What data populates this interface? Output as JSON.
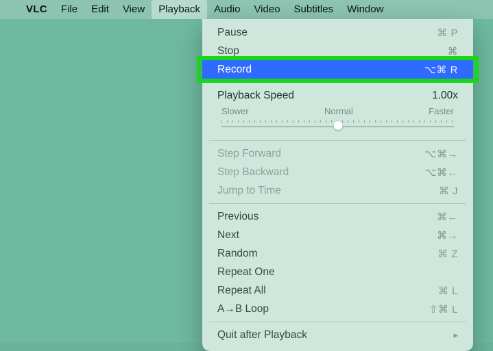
{
  "menubar": {
    "app": "VLC",
    "items": [
      "File",
      "Edit",
      "View",
      "Playback",
      "Audio",
      "Video",
      "Subtitles",
      "Window"
    ],
    "open_index": 3
  },
  "menu": {
    "pause": {
      "label": "Pause",
      "shortcut": "⌘ P"
    },
    "stop": {
      "label": "Stop",
      "shortcut": "⌘"
    },
    "record": {
      "label": "Record",
      "shortcut": "⌥⌘ R"
    },
    "speed": {
      "label": "Playback Speed",
      "value": "1.00x",
      "slower": "Slower",
      "normal": "Normal",
      "faster": "Faster",
      "position_pct": 50
    },
    "stepfwd": {
      "label": "Step Forward",
      "shortcut": "⌥⌘→"
    },
    "stepbwd": {
      "label": "Step Backward",
      "shortcut": "⌥⌘←"
    },
    "jump": {
      "label": "Jump to Time",
      "shortcut": "⌘ J"
    },
    "prev": {
      "label": "Previous",
      "shortcut": "⌘←"
    },
    "next": {
      "label": "Next",
      "shortcut": "⌘→"
    },
    "random": {
      "label": "Random",
      "shortcut": "⌘ Z"
    },
    "rep1": {
      "label": "Repeat One"
    },
    "repa": {
      "label": "Repeat All",
      "shortcut": "⌘ L"
    },
    "abloop": {
      "label": "A→B Loop",
      "shortcut": "⇧⌘ L"
    },
    "quit": {
      "label": "Quit after Playback"
    }
  }
}
